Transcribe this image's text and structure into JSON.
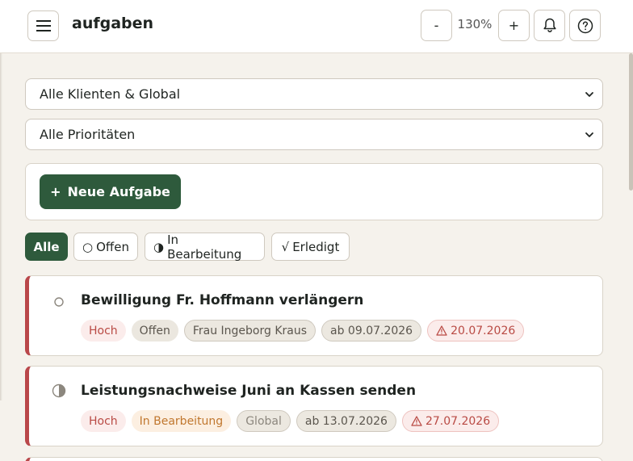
{
  "header": {
    "title": "aufgaben",
    "zoom_minus": "-",
    "zoom_value": "130%",
    "zoom_plus": "+"
  },
  "filters": {
    "client_select": "Alle Klienten & Global",
    "priority_select": "Alle Prioritäten"
  },
  "new_task": {
    "plus": "+",
    "label": "Neue Aufgabe"
  },
  "status_tabs": [
    {
      "icon": "",
      "label": "Alle",
      "active": true
    },
    {
      "icon": "○",
      "label": "Offen",
      "active": false
    },
    {
      "icon": "◑",
      "label": "In Bearbeitung",
      "active": false
    },
    {
      "icon": "√",
      "label": "Erledigt",
      "active": false
    }
  ],
  "tasks": [
    {
      "title": "Bewilligung Fr. Hoffmann verlängern",
      "priority": "Hoch",
      "status": "Offen",
      "client": "Frau Ingeborg Kraus",
      "start": "ab 09.07.2026",
      "due": "20.07.2026"
    },
    {
      "title": "Leistungsnachweise Juni an Kassen senden",
      "priority": "Hoch",
      "status": "In Bearbeitung",
      "client": "Global",
      "start": "ab 13.07.2026",
      "due": "27.07.2026"
    }
  ],
  "colors": {
    "accent": "#2e5a3c",
    "priority_high": "#b94a44",
    "background": "#f5f2ec"
  }
}
